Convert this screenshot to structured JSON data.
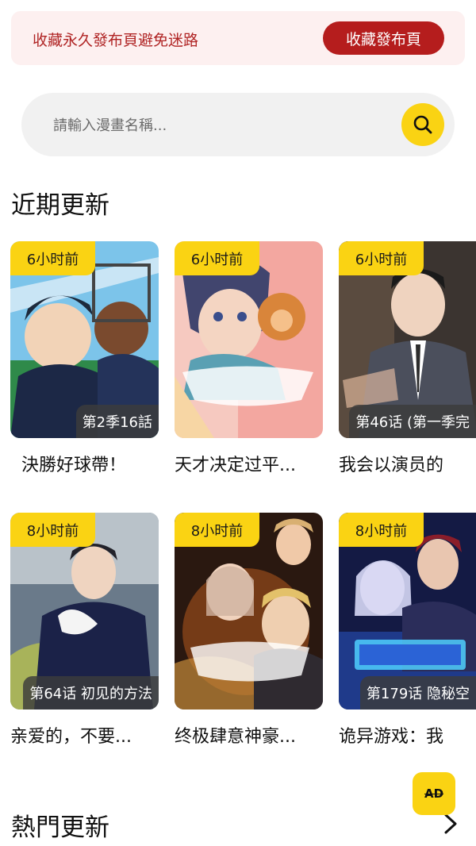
{
  "banner": {
    "text": "收藏永久發布頁避免迷路",
    "button": "收藏發布頁"
  },
  "search": {
    "placeholder": "請輸入漫畫名稱..."
  },
  "recent": {
    "title": "近期更新",
    "items": [
      {
        "time": "6小时前",
        "episode": "第2季16話",
        "title": "決勝好球帶！"
      },
      {
        "time": "6小时前",
        "episode": "",
        "title": "天才决定过平..."
      },
      {
        "time": "6小时前",
        "episode": "第46话 (第一季完",
        "title": "我会以演员的"
      },
      {
        "time": "8小时前",
        "episode": "第64话 初见的方法",
        "title": "亲爱的，不要..."
      },
      {
        "time": "8小时前",
        "episode": "",
        "title": "终极肆意神豪..."
      },
      {
        "time": "8小时前",
        "episode": "第179话 隐秘空",
        "title": "诡异游戏：我"
      }
    ]
  },
  "hot": {
    "title": "熱門更新"
  },
  "ad": {
    "label": "AD"
  },
  "colors": {
    "accent_yellow": "#fad313",
    "banner_red": "#b51d1d",
    "banner_bg": "#fdf0f0"
  }
}
